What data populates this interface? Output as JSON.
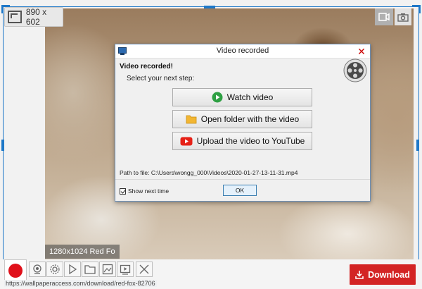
{
  "capture": {
    "size_label": "890 x 602",
    "image_label": "1280x1024 Red Fo",
    "url": "https://wallpaperaccess.com/download/red-fox-82706"
  },
  "dialog": {
    "title": "Video recorded",
    "heading": "Video recorded!",
    "subheading": "Select your next step:",
    "buttons": {
      "watch": "Watch video",
      "folder": "Open folder with the video",
      "youtube": "Upload the video to YouTube"
    },
    "path": "Path to file: C:\\Users\\wongg_000\\Videos\\2020-01-27-13-11-31.mp4",
    "show_next_time": "Show next time",
    "ok": "OK"
  },
  "toolbar": {
    "download": "Download",
    "tools": [
      "webcam-icon",
      "settings-icon",
      "play-icon",
      "folder-icon",
      "image-icon",
      "video-icon",
      "close-icon"
    ]
  },
  "colors": {
    "accent": "#1e78c8",
    "record": "#e0101a",
    "download": "#d32424",
    "watch_green": "#2ea043",
    "folder_yellow": "#f2b632",
    "youtube_red": "#e62117"
  }
}
